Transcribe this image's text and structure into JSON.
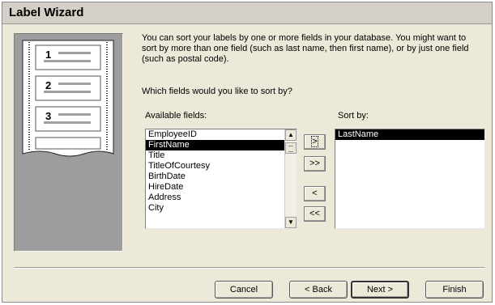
{
  "window": {
    "title": "Label Wizard"
  },
  "intro": "You can sort your labels by one or more fields in your database.  You might want to sort by more than one field (such as last name, then first name), or by just one field (such as postal code).",
  "question": "Which fields would you like to sort by?",
  "available": {
    "label": "Available fields:",
    "items": [
      "EmployeeID",
      "FirstName",
      "Title",
      "TitleOfCourtesy",
      "BirthDate",
      "HireDate",
      "Address",
      "City"
    ],
    "selected_index": 1
  },
  "sort_by": {
    "label": "Sort by:",
    "items": [
      "LastName"
    ],
    "selected_index": 0
  },
  "move_buttons": {
    "add_one": ">",
    "add_all": ">>",
    "remove_one": "<",
    "remove_all": "<<"
  },
  "art": {
    "numbers": [
      "1",
      "2",
      "3"
    ]
  },
  "footer": {
    "cancel": "Cancel",
    "back": "< Back",
    "next": "Next >",
    "finish": "Finish"
  }
}
